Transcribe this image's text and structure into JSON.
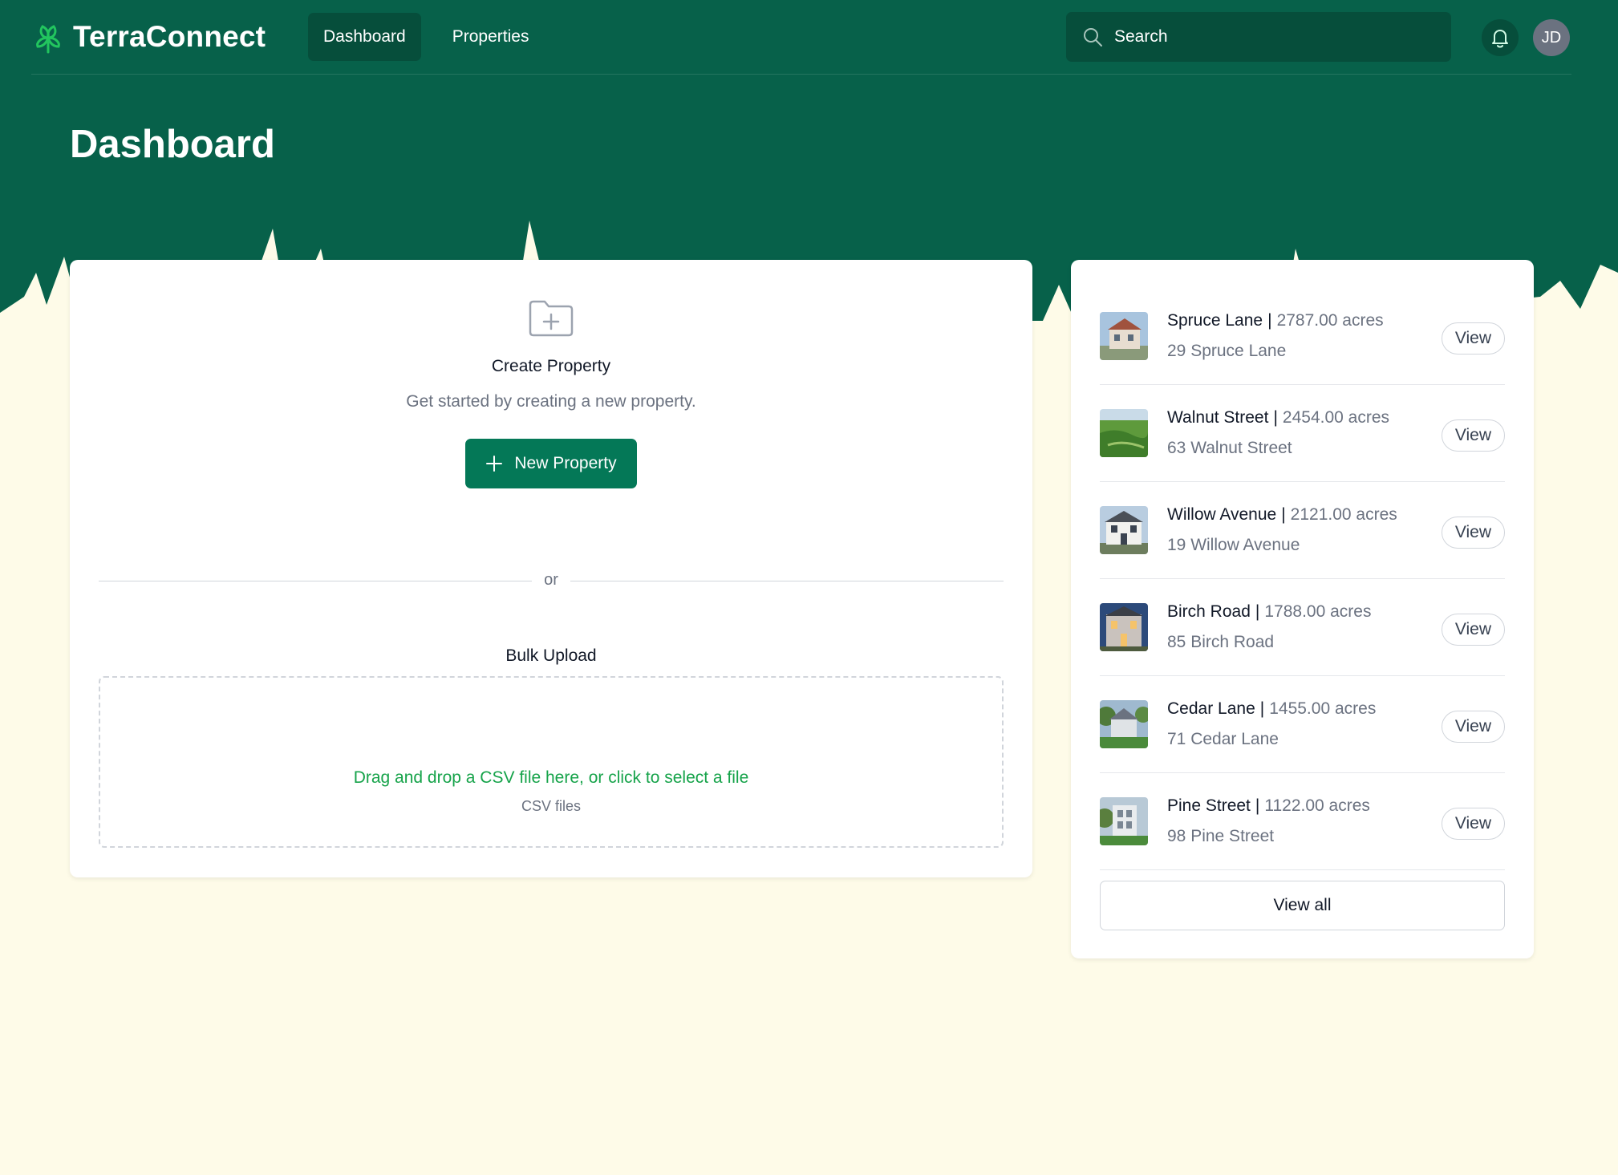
{
  "brand": {
    "name": "TerraConnect"
  },
  "nav": {
    "links": [
      {
        "label": "Dashboard"
      },
      {
        "label": "Properties"
      }
    ]
  },
  "search": {
    "placeholder": "Search"
  },
  "user": {
    "initials": "JD"
  },
  "page": {
    "title": "Dashboard"
  },
  "create": {
    "title": "Create Property",
    "description": "Get started by creating a new property.",
    "button_label": "New Property"
  },
  "divider": {
    "label": "or"
  },
  "bulk": {
    "title": "Bulk Upload",
    "drop_text": "Drag and drop a CSV file here, or click to select a file",
    "file_types": "CSV files"
  },
  "properties": [
    {
      "name": "Spruce Lane",
      "acres": "2787.00 acres",
      "address": "29 Spruce Lane",
      "action": "View"
    },
    {
      "name": "Walnut Street",
      "acres": "2454.00 acres",
      "address": "63 Walnut Street",
      "action": "View"
    },
    {
      "name": "Willow Avenue",
      "acres": "2121.00 acres",
      "address": "19 Willow Avenue",
      "action": "View"
    },
    {
      "name": "Birch Road",
      "acres": "1788.00 acres",
      "address": "85 Birch Road",
      "action": "View"
    },
    {
      "name": "Cedar Lane",
      "acres": "1455.00 acres",
      "address": "71 Cedar Lane",
      "action": "View"
    },
    {
      "name": "Pine Street",
      "acres": "1122.00 acres",
      "address": "98 Pine Street",
      "action": "View"
    }
  ],
  "view_all_label": "View all",
  "colors": {
    "hero": "#07614a",
    "nav_active": "#064e3b",
    "primary_button": "#047857",
    "page_background": "#fefbe8",
    "drop_text": "#16a34a"
  },
  "icons": {
    "logo": "leaf-icon",
    "search": "search-icon",
    "notifications": "bell-icon",
    "create": "folder-plus-icon",
    "new_button": "plus-icon"
  }
}
